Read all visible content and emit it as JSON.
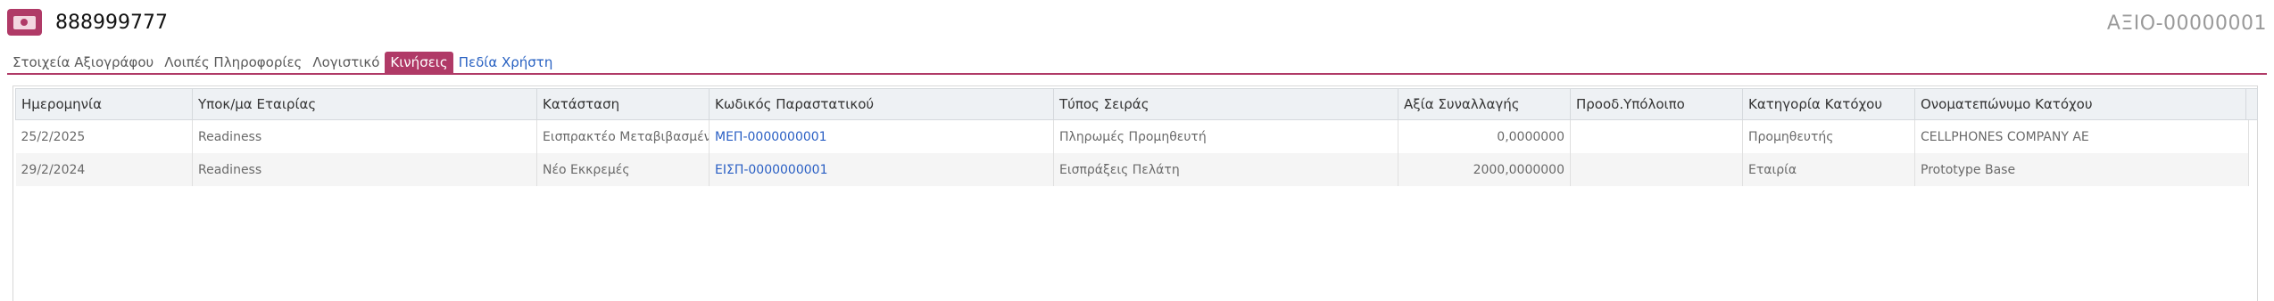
{
  "header": {
    "title": "888999777",
    "document_number": "ΑΞΙΟ-00000001",
    "icon": "banknote-icon"
  },
  "tabs": [
    {
      "label": "Στοιχεία Αξιογράφου",
      "active": false
    },
    {
      "label": "Λοιπές Πληροφορίες",
      "active": false
    },
    {
      "label": "Λογιστικό",
      "active": false
    },
    {
      "label": "Κινήσεις",
      "active": true
    },
    {
      "label": "Πεδία Χρήστη",
      "active": false
    }
  ],
  "table": {
    "columns": [
      "Ημερομηνία",
      "Υποκ/μα Εταιρίας",
      "Κατάσταση",
      "Κωδικός Παραστατικού",
      "Τύπος Σειράς",
      "Αξία Συναλλαγής",
      "Προοδ.Υπόλοιπο",
      "Κατηγορία Κατόχου",
      "Ονοματεπώνυμο Κατόχου"
    ],
    "rows": [
      [
        "25/2/2025",
        "Readiness",
        "Εισπρακτέο Μεταβιβασμένο",
        "ΜΕΠ-0000000001",
        "Πληρωμές Προμηθευτή",
        "0,0000000",
        "",
        "Προμηθευτής",
        "CELLPHONES COMPANY AE"
      ],
      [
        "29/2/2024",
        "Readiness",
        "Νέο Εκκρεμές",
        "ΕΙΣΠ-0000000001",
        "Εισπράξεις Πελάτη",
        "2000,0000000",
        "",
        "Εταιρία",
        "Prototype Base"
      ]
    ]
  },
  "colors": {
    "accent": "#b03a67",
    "link": "#2a5fc4",
    "header_bg": "#eef1f4"
  }
}
